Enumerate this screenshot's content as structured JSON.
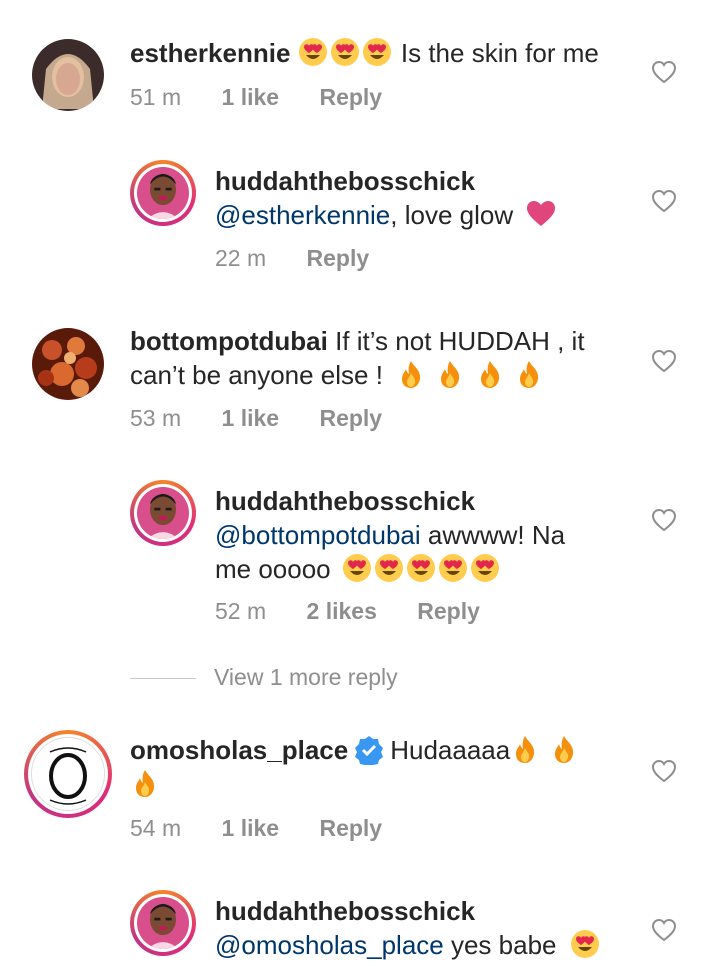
{
  "comments": [
    {
      "username": "estherkennie",
      "text": "Is the skin for me",
      "time": "51 m",
      "likes": "1 like",
      "reply": "Reply"
    },
    {
      "username": "huddahthebosschick",
      "mention": "@estherkennie",
      "text": ", love glow",
      "time": "22 m",
      "reply": "Reply"
    },
    {
      "username": "bottompotdubai",
      "text_line1": "If it’s not HUDDAH , it",
      "text_line2": "can’t be anyone else !",
      "time": "53 m",
      "likes": "1 like",
      "reply": "Reply"
    },
    {
      "username": "huddahthebosschick",
      "mention": "@bottompotdubai",
      "text_line1": " awwww! Na",
      "text_line2": "me ooooo",
      "time": "52 m",
      "likes": "2 likes",
      "reply": "Reply"
    },
    {
      "username": "omosholas_place",
      "text": "Hudaaaaa",
      "time": "54 m",
      "likes": "1 like",
      "reply": "Reply"
    },
    {
      "username": "huddahthebosschick",
      "mention": "@omosholas_place",
      "text": " yes babe"
    }
  ],
  "view_more": "View 1 more reply",
  "colors": {
    "username": "#262626",
    "mention": "#00376b",
    "meta": "#8e8e8e",
    "heart_emoji": "#e0457b",
    "verified": "#3897f0"
  },
  "icons": {
    "like": "heart-outline-icon",
    "verified": "verified-badge-icon",
    "emoji_heart_eyes": "heart-eyes-emoji",
    "emoji_fire": "fire-emoji",
    "emoji_heart": "pink-heart-emoji"
  }
}
